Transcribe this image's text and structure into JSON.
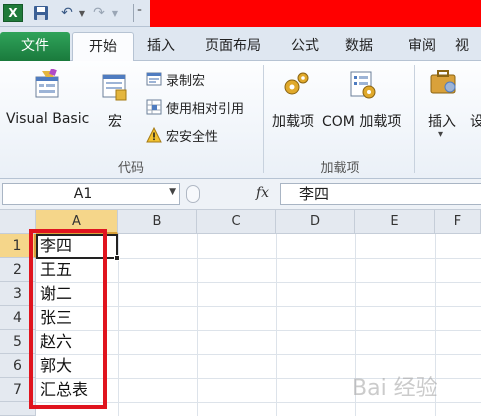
{
  "quick_access": {
    "app_icon": "X",
    "save_icon": "save-icon",
    "undo_icon": "↶",
    "redo_icon": "↷",
    "dropdown": "▼",
    "customize": "⁼"
  },
  "tabs": {
    "file": "文件",
    "home": "开始",
    "insert": "插入",
    "page_layout": "页面布局",
    "formulas": "公式",
    "data": "数据",
    "review": "审阅",
    "view": "视"
  },
  "ribbon": {
    "code_group": {
      "label": "代码",
      "visual_basic": "Visual Basic",
      "macros": "宏",
      "record_macro": "录制宏",
      "relative_refs": "使用相对引用",
      "macro_security": "宏安全性"
    },
    "addins_group": {
      "label": "加载项",
      "addins": "加载项",
      "com_addins": "COM 加载项"
    },
    "controls_group": {
      "insert": "插入",
      "insert_drop": "▾",
      "design_partial": "设"
    }
  },
  "formula_bar": {
    "name_box": "A1",
    "name_drop": "▼",
    "fx": "fx",
    "content": "李四"
  },
  "sheet": {
    "columns": [
      "A",
      "B",
      "C",
      "D",
      "E",
      "F"
    ],
    "rows": [
      "1",
      "2",
      "3",
      "4",
      "5",
      "6",
      "7"
    ],
    "column_a": [
      "李四",
      "王五",
      "谢二",
      "张三",
      "赵六",
      "郭大",
      "汇总表"
    ]
  },
  "watermark": "Bai 经验",
  "colors": {
    "file_tab": "#1e8a44",
    "highlight": "#e0141e",
    "selected_header": "#f5d68a"
  }
}
